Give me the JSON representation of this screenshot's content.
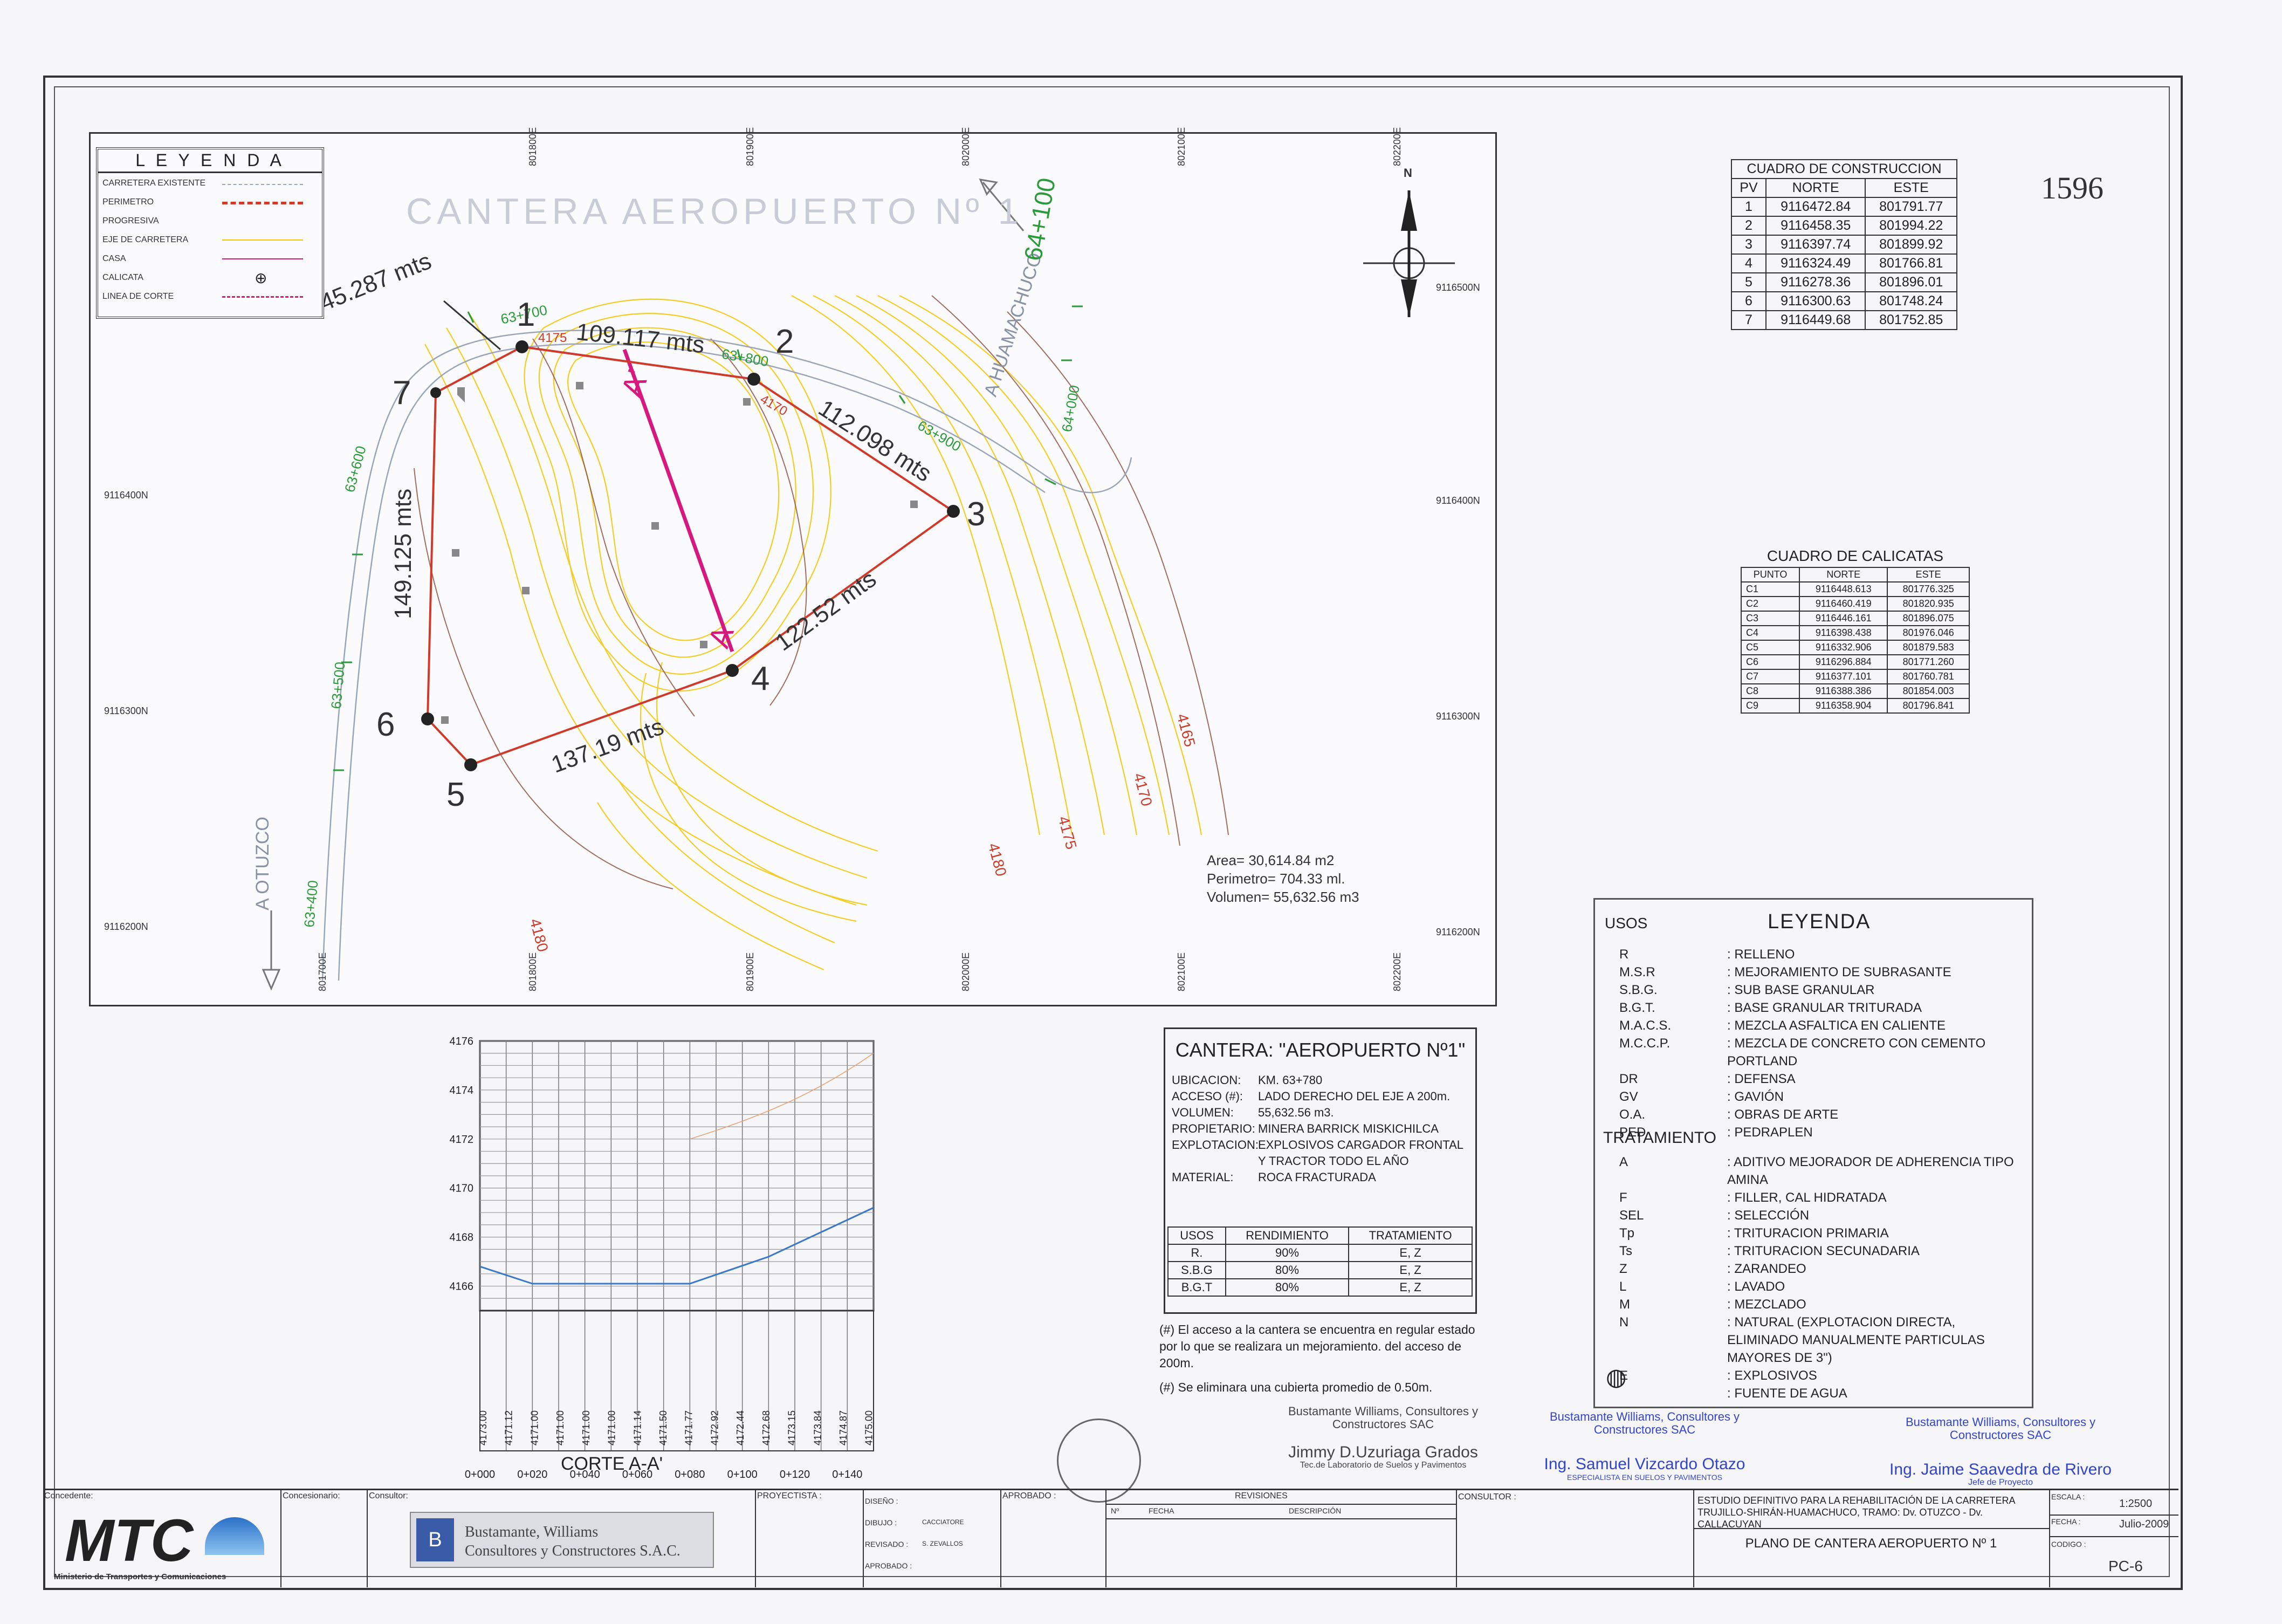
{
  "page_number": "1596",
  "map": {
    "watermark_title": "CANTERA AEROPUERTO Nº 1",
    "road_left": "A OTUZCO",
    "road_right": "A HUAMACHUCO",
    "progressive_big": "64+100",
    "progressives": [
      "63+700",
      "63+800",
      "63+900",
      "64+000",
      "63+600",
      "63+500",
      "63+400"
    ],
    "side_lengths": [
      "45.287 mts",
      "109.117 mts",
      "112.098 mts",
      "122.52 mts",
      "137.19 mts",
      "149.125 mts"
    ],
    "vertices": [
      "1",
      "2",
      "3",
      "4",
      "5",
      "6",
      "7"
    ],
    "section_marks": [
      "A'",
      "A"
    ],
    "contours": [
      "4175",
      "4170",
      "4165",
      "4170",
      "4175",
      "4180",
      "4180"
    ],
    "east_ticks": [
      "801800E",
      "801900E",
      "802000E",
      "802100E",
      "802200E",
      "801700E",
      "801800E",
      "801900E",
      "802000E",
      "802100E",
      "802200E"
    ],
    "north_ticks": [
      "9116500N",
      "9116400N",
      "9116300N",
      "9116200N",
      "9116400N",
      "9116300N",
      "9116200N"
    ],
    "north_arrow": "N",
    "summary": [
      "Area= 30,614.84 m2",
      "Perimetro= 704.33 ml.",
      "Volumen= 55,632.56 m3"
    ]
  },
  "map_legend": {
    "title": "L E Y E N D A",
    "items": [
      "CARRETERA EXISTENTE",
      "PERIMETRO",
      "PROGRESIVA",
      "EJE DE CARRETERA",
      "CASA",
      "CALICATA",
      "LINEA DE CORTE"
    ]
  },
  "construction_table": {
    "title": "CUADRO DE CONSTRUCCION",
    "headers": [
      "PV",
      "NORTE",
      "ESTE"
    ],
    "rows": [
      [
        "1",
        "9116472.84",
        "801791.77"
      ],
      [
        "2",
        "9116458.35",
        "801994.22"
      ],
      [
        "3",
        "9116397.74",
        "801899.92"
      ],
      [
        "4",
        "9116324.49",
        "801766.81"
      ],
      [
        "5",
        "9116278.36",
        "801896.01"
      ],
      [
        "6",
        "9116300.63",
        "801748.24"
      ],
      [
        "7",
        "9116449.68",
        "801752.85"
      ]
    ]
  },
  "calicatas_table": {
    "title": "CUADRO DE CALICATAS",
    "headers": [
      "PUNTO",
      "NORTE",
      "ESTE"
    ],
    "rows": [
      [
        "C1",
        "9116448.613",
        "801776.325"
      ],
      [
        "C2",
        "9116460.419",
        "801820.935"
      ],
      [
        "C3",
        "9116446.161",
        "801896.075"
      ],
      [
        "C4",
        "9116398.438",
        "801976.046"
      ],
      [
        "C5",
        "9116332.906",
        "801879.583"
      ],
      [
        "C6",
        "9116296.884",
        "801771.260"
      ],
      [
        "C7",
        "9116377.101",
        "801760.781"
      ],
      [
        "C8",
        "9116388.386",
        "801854.003"
      ],
      [
        "C9",
        "9116358.904",
        "801796.841"
      ]
    ]
  },
  "quarry_info": {
    "title": "CANTERA: \"AEROPUERTO Nº1\"",
    "fields": [
      {
        "k": "UBICACION:",
        "v": "KM. 63+780"
      },
      {
        "k": "ACCESO (#):",
        "v": "LADO DERECHO DEL EJE A 200m."
      },
      {
        "k": "VOLUMEN:",
        "v": "55,632.56 m3."
      },
      {
        "k": "PROPIETARIO:",
        "v": "MINERA BARRICK MISKICHILCA"
      },
      {
        "k": "EXPLOTACION:",
        "v": "EXPLOSIVOS CARGADOR FRONTAL Y TRACTOR TODO EL AÑO"
      },
      {
        "k": "MATERIAL:",
        "v": "ROCA FRACTURADA"
      }
    ],
    "yield_headers": [
      "USOS",
      "RENDIMIENTO",
      "TRATAMIENTO"
    ],
    "yield_rows": [
      [
        "R.",
        "90%",
        "E, Z"
      ],
      [
        "S.B.G",
        "80%",
        "E, Z"
      ],
      [
        "B.G.T",
        "80%",
        "E, Z"
      ]
    ],
    "notes": [
      "(#) El acceso a la cantera se encuentra en regular estado por lo que se realizara un mejoramiento. del acceso de 200m.",
      "(#) Se eliminara una cubierta promedio de 0.50m."
    ]
  },
  "uses_legend": {
    "usos_label": "USOS",
    "title": "LEYENDA",
    "usos": [
      [
        "R",
        ": RELLENO"
      ],
      [
        "M.S.R",
        ": MEJORAMIENTO DE SUBRASANTE"
      ],
      [
        "S.B.G.",
        ": SUB BASE GRANULAR"
      ],
      [
        "B.G.T.",
        ": BASE GRANULAR TRITURADA"
      ],
      [
        "M.A.C.S.",
        ": MEZCLA ASFALTICA EN CALIENTE"
      ],
      [
        "M.C.C.P.",
        ": MEZCLA DE CONCRETO CON CEMENTO PORTLAND"
      ],
      [
        "DR",
        ": DEFENSA"
      ],
      [
        "GV",
        ": GAVIÓN"
      ],
      [
        "O.A.",
        ": OBRAS DE ARTE"
      ],
      [
        "PED",
        ": PEDRAPLEN"
      ]
    ],
    "tratamiento_label": "TRATAMIENTO",
    "tratamiento": [
      [
        "A",
        ": ADITIVO MEJORADOR DE ADHERENCIA TIPO AMINA"
      ],
      [
        "F",
        ": FILLER, CAL HIDRATADA"
      ],
      [
        "SEL",
        ": SELECCIÓN"
      ],
      [
        "Tp",
        ": TRITURACION PRIMARIA"
      ],
      [
        "Ts",
        ": TRITURACION SECUNADARIA"
      ],
      [
        "Z",
        ": ZARANDEO"
      ],
      [
        "L",
        ": LAVADO"
      ],
      [
        "M",
        ": MEZCLADO"
      ],
      [
        "N",
        ": NATURAL (EXPLOTACION DIRECTA, ELIMINADO MANUALMENTE PARTICULAS MAYORES DE 3\")"
      ],
      [
        "E",
        ": EXPLOSIVOS"
      ],
      [
        "",
        ": FUENTE DE AGUA"
      ]
    ]
  },
  "profile": {
    "caption": "CORTE A-A'",
    "y_ticks": [
      "4176",
      "4174",
      "4172",
      "4170",
      "4168",
      "4166"
    ],
    "x_ticks": [
      "0+000",
      "0+020",
      "0+040",
      "0+060",
      "0+080",
      "0+100",
      "0+120",
      "0+140"
    ],
    "elevations": [
      "4173.00",
      "4171.12",
      "4171.00",
      "4171.00",
      "4171.00",
      "4171.00",
      "4171.14",
      "4171.50",
      "4171.77",
      "4172.92",
      "4172.44",
      "4172.68",
      "4173.15",
      "4173.84",
      "4174.87",
      "4175.00"
    ]
  },
  "chart_data": {
    "type": "line",
    "title": "",
    "xlabel": "",
    "ylabel": "",
    "x": [
      0,
      20,
      40,
      60,
      70,
      80,
      110,
      150
    ],
    "series": [
      {
        "values": [
          4166.8,
          4166.1,
          4166.1,
          4166.1,
          4166.1,
          4166.1,
          4167.2,
          4169.2
        ]
      }
    ],
    "ylim": [
      4165,
      4176
    ],
    "xlim": [
      0,
      150
    ],
    "grid": true
  },
  "title_block": {
    "concedente": "Concedente:",
    "concesionario": "Concesionario:",
    "consultor": "Consultor:",
    "mtc_logo": "MTC",
    "mtc_sub": "Ministerio de Transportes y Comunicaciones",
    "company_1": "Bustamante, Williams",
    "company_2": "Consultores y Constructores S.A.C.",
    "proyectista": "PROYECTISTA :",
    "diseno": "DISEÑO :",
    "dibujo": "DIBUJO :",
    "dibujo_v": "CACCIATORE",
    "revisado": "REVISADO :",
    "revisado_v": "S. ZEVALLOS",
    "aprobado": "APROBADO :",
    "aprobado_top": "APROBADO :",
    "revisiones": "REVISIONES",
    "rev_no": "Nº",
    "rev_fecha": "FECHA",
    "rev_desc": "DESCRIPCIÓN",
    "consultor2": "CONSULTOR :",
    "project": "ESTUDIO DEFINITIVO PARA LA REHABILITACIÓN DE LA CARRETERA TRUJILLO-SHIRÁN-HUAMACHUCO, TRAMO: Dv. OTUZCO - Dv. CALLACUYAN",
    "plan": "PLANO DE CANTERA AEROPUERTO Nº 1",
    "escala": "ESCALA :",
    "escala_v": "1:2500",
    "fecha": "FECHA :",
    "fecha_v": "Julio-2009",
    "codigo": "CODIGO :",
    "codigo_v": "PC-6"
  },
  "signatures": [
    {
      "company": "Bustamante Williams, Consultores y Constructores SAC",
      "name": "Jimmy D.Uzuriaga Grados",
      "role": "Tec.de Laboratorio de Suelos y Pavimentos"
    },
    {
      "company": "Bustamante Williams, Consultores y Constructores SAC",
      "name": "Ing. Samuel Vizcardo Otazo",
      "role": "ESPECIALISTA EN SUELOS Y PAVIMENTOS"
    },
    {
      "company": "Bustamante Williams, Consultores y Constructores SAC",
      "name": "Ing. Jaime Saavedra de Rivero",
      "role": "Jefe de Proyecto"
    }
  ]
}
